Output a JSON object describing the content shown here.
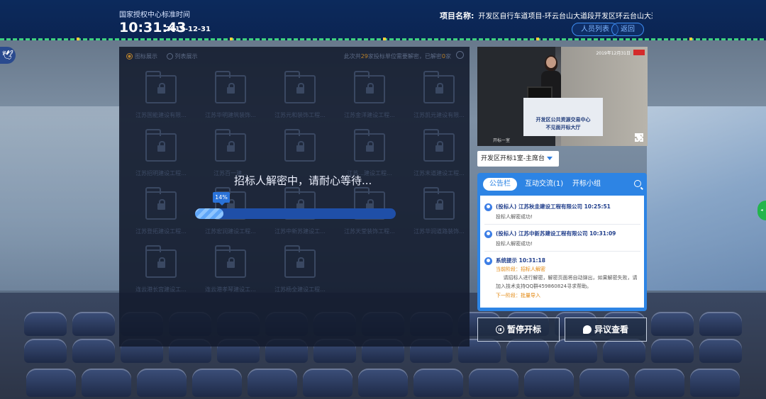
{
  "header": {
    "clock_label": "国家授权中心标准时间",
    "time": "10:31:43",
    "date": "2019-12-31",
    "project_label": "项目名称:",
    "project_name": "开发区自行车道项目-环云台山大道段开发区环云台山大道段自行车道...",
    "persons_button": "人员列表",
    "back_button": "返回"
  },
  "main": {
    "radio_icon": "图标展示",
    "radio_list": "列表展示",
    "stat_prefix": "此次共",
    "stat_count": "29",
    "stat_suffix": "家投标单位需要解密，已解密",
    "stat_done": "0",
    "stat_unit": "家",
    "decrypt_message": "招标人解密中，请耐心等待...",
    "progress_label": "14%",
    "progress": 0.14,
    "tiles": [
      "江苏国能建设有限...",
      "江苏华明建筑装饰...",
      "江苏元和装饰工程...",
      "江苏金洋建设工程...",
      "江苏凯元建设有限...",
      "江苏招明建设工程...",
      "江苏百一建...",
      "",
      "江苏...建设工程...",
      "江苏末道建设工程...",
      "江苏登拓建设工程...",
      "江苏宏润建设工程...",
      "江苏中新苏建设工...",
      "江苏天堂装饰工程...",
      "江苏华润道路装饰...",
      "连云港长宫建设工...",
      "连云港孝琴建设工...",
      "江苏杨全建设工程..."
    ]
  },
  "video": {
    "timestamp": "2019年12月31日",
    "caption": "开标一室",
    "desk_line1": "开发区公共资源交易中心",
    "desk_line2": "不见面开标大厅"
  },
  "room_select": {
    "value": "开发区开标1室-主席台"
  },
  "notice": {
    "tabs": [
      "公告栏",
      "互动交流(1)",
      "开标小组"
    ],
    "messages": [
      {
        "title": "(投标人) 江苏秋圭建设工程有限公司 10:25:51",
        "text": "投标人解密成功!"
      },
      {
        "title": "(投标人) 江苏中新苏建设工程有限公司 10:31:09",
        "text": "投标人解密成功!"
      },
      {
        "title": "系统提示 10:31:18",
        "stage": "当前阶段：招标人解密",
        "text": "请招标人进行解密，解密页面将自动弹出，如果解密失败，请加入技术支持QQ群459860824寻求帮助。",
        "next": "下一阶段：批量导入"
      }
    ]
  },
  "actions": {
    "pause": "暂停开标",
    "objection": "异议查看"
  }
}
